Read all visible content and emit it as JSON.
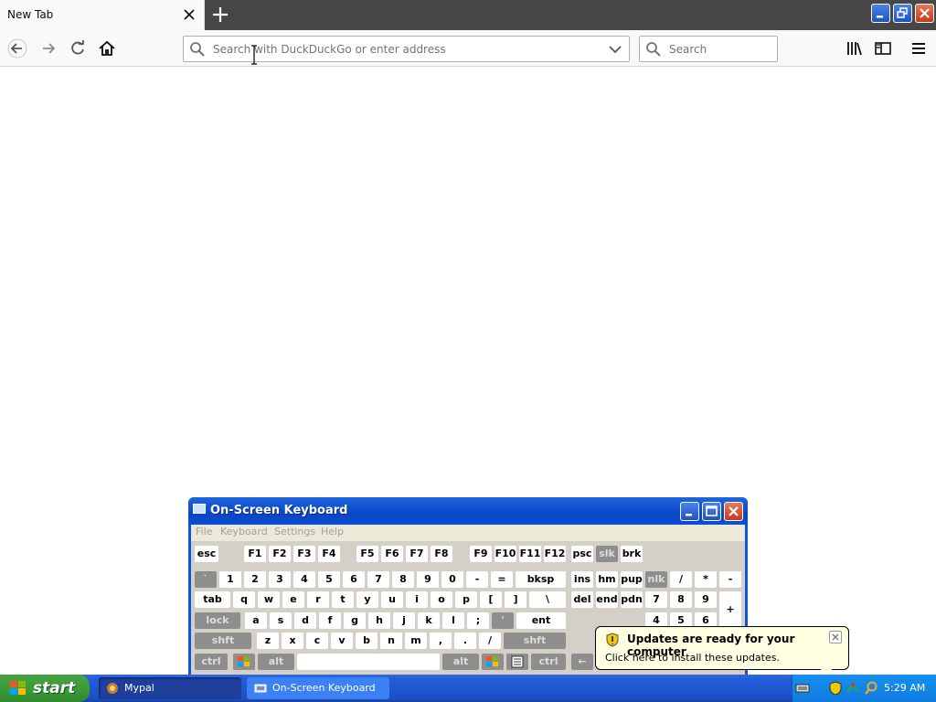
{
  "browser": {
    "tab": {
      "title": "New Tab",
      "close_icon": "close-icon"
    },
    "new_tab_icon": "plus-icon",
    "window_controls": [
      "minimize-icon",
      "restore-icon",
      "close-icon"
    ],
    "toolbar": {
      "back_icon": "back-arrow-icon",
      "forward_icon": "forward-arrow-icon",
      "reload_icon": "reload-icon",
      "home_icon": "home-icon",
      "url_placeholder": "Search with DuckDuckGo or enter address",
      "url_value": "",
      "search_placeholder": "Search",
      "library_icon": "library-icon",
      "sidebar_icon": "sidebar-icon",
      "menu_icon": "hamburger-menu-icon"
    }
  },
  "osk": {
    "title": "On-Screen Keyboard",
    "menu": [
      "File",
      "Keyboard",
      "Settings",
      "Help"
    ],
    "rows": {
      "fn": [
        "esc",
        "F1",
        "F2",
        "F3",
        "F4",
        "F5",
        "F6",
        "F7",
        "F8",
        "F9",
        "F10",
        "F11",
        "F12",
        "psc",
        "slk",
        "brk"
      ],
      "num": [
        "`",
        "1",
        "2",
        "3",
        "4",
        "5",
        "6",
        "7",
        "8",
        "9",
        "0",
        "-",
        "=",
        "bksp",
        "ins",
        "hm",
        "pup",
        "nlk",
        "/",
        "*",
        "-"
      ],
      "top": [
        "tab",
        "q",
        "w",
        "e",
        "r",
        "t",
        "y",
        "u",
        "i",
        "o",
        "p",
        "[",
        "]",
        "\\",
        "del",
        "end",
        "pdn",
        "7",
        "8",
        "9",
        "+"
      ],
      "home": [
        "lock",
        "a",
        "s",
        "d",
        "f",
        "g",
        "h",
        "j",
        "k",
        "l",
        ";",
        "'",
        "ent",
        "4",
        "5",
        "6"
      ],
      "bottom": [
        "shft",
        "z",
        "x",
        "c",
        "v",
        "b",
        "n",
        "m",
        ",",
        ".",
        "/",
        "shft"
      ],
      "space": [
        "ctrl",
        "alt",
        "alt",
        "ctrl",
        "←"
      ]
    }
  },
  "taskbar": {
    "start": "start",
    "tasks": [
      {
        "label": "Mypal",
        "icon": "mypal-icon",
        "active": true
      },
      {
        "label": "On-Screen Keyboard",
        "icon": "keyboard-icon",
        "active": false
      }
    ],
    "clock": "5:29 AM",
    "tray_icons": [
      "keyboard-tray-icon",
      "security-shield-icon",
      "network-icon",
      "search-tray-icon"
    ]
  },
  "balloon": {
    "title": "Updates are ready for your computer",
    "text": "Click here to install these updates."
  },
  "colors": {
    "xp_blue": "#245edb",
    "start_green": "#3c9b3a",
    "tab_bar": "#474749",
    "toolbar": "#f9f9fa"
  }
}
